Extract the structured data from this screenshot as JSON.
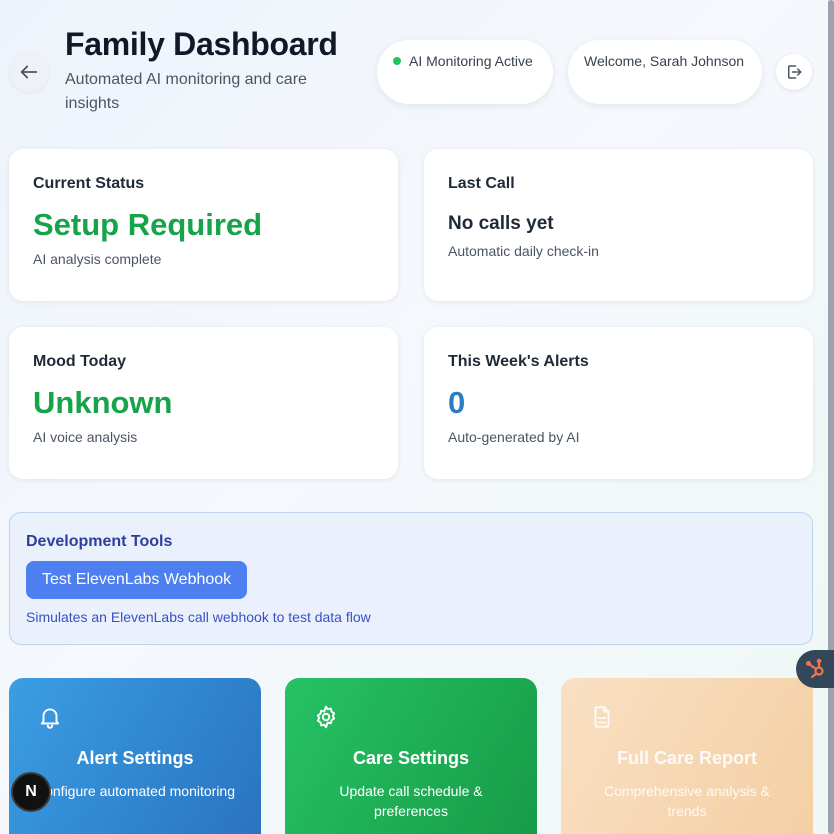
{
  "header": {
    "title": "Family Dashboard",
    "subtitle": "Automated AI monitoring and care insights",
    "monitoring_status": "AI Monitoring Active",
    "welcome": "Welcome, Sarah Johnson"
  },
  "cards": {
    "current_status": {
      "label": "Current Status",
      "value": "Setup Required",
      "note": "AI analysis complete"
    },
    "last_call": {
      "label": "Last Call",
      "value": "No calls yet",
      "note": "Automatic daily check-in"
    },
    "mood_today": {
      "label": "Mood Today",
      "value": "Unknown",
      "note": "AI voice analysis"
    },
    "weekly_alerts": {
      "label": "This Week's Alerts",
      "value": "0",
      "note": "Auto-generated by AI"
    }
  },
  "dev_tools": {
    "title": "Development Tools",
    "button_label": "Test ElevenLabs Webhook",
    "note": "Simulates an ElevenLabs call webhook to test data flow"
  },
  "actions": [
    {
      "icon": "bell-icon",
      "title": "Alert Settings",
      "description": "Configure automated monitoring"
    },
    {
      "icon": "gear-icon",
      "title": "Care Settings",
      "description": "Update call schedule & preferences"
    },
    {
      "icon": "document-icon",
      "title": "Full Care Report",
      "description": "Comprehensive analysis & trends"
    }
  ],
  "badges": {
    "next_letter": "N"
  },
  "colors": {
    "status_green": "#16a34a",
    "alerts_blue": "#2b7bc6",
    "webhook_button": "#4d7ff0",
    "alert_card": "#2a72c0",
    "care_card": "#179a47",
    "report_card": "#f3cfa3"
  }
}
